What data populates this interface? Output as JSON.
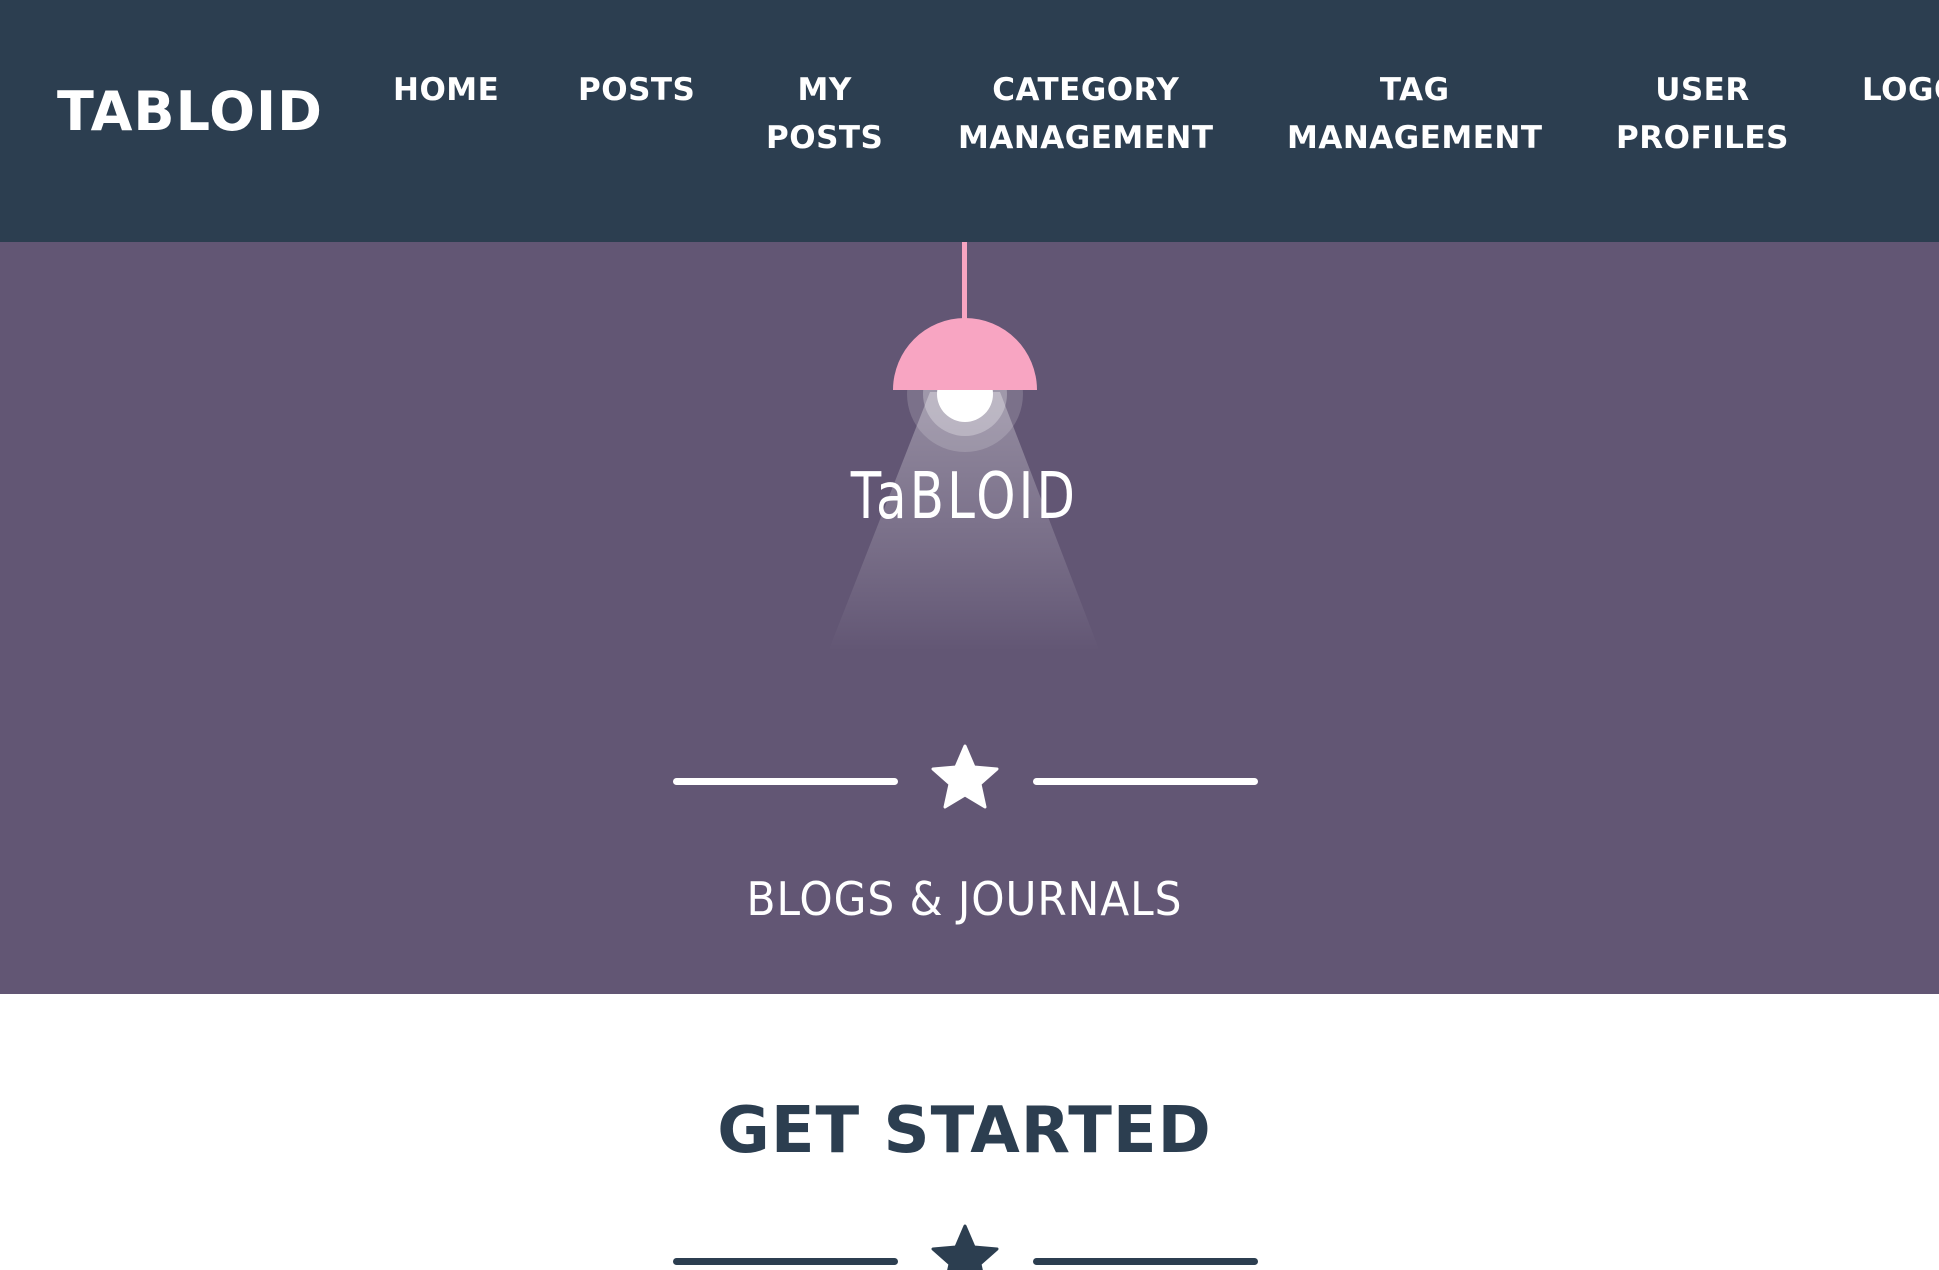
{
  "navbar": {
    "brand": "TABLOID",
    "items": [
      {
        "lines": [
          "HOME"
        ]
      },
      {
        "lines": [
          "POSTS"
        ]
      },
      {
        "lines": [
          "MY",
          "POSTS"
        ]
      },
      {
        "lines": [
          "CATEGORY",
          "MANAGEMENT"
        ]
      },
      {
        "lines": [
          "TAG",
          "MANAGEMENT"
        ]
      },
      {
        "lines": [
          "USER",
          "PROFILES"
        ]
      },
      {
        "lines": [
          "LOGOUT"
        ]
      }
    ]
  },
  "masthead": {
    "logo_text": "TaBLOID",
    "subheading": "BLOGS & JOURNALS",
    "divider_icon": "star-icon"
  },
  "section": {
    "title": "GET STARTED",
    "divider_icon": "star-icon"
  },
  "colors": {
    "navbar_bg": "#2c3e50",
    "masthead_bg": "#625674",
    "lamp_shade": "#f8a5c2",
    "heading_dark": "#2c3e50",
    "white": "#ffffff"
  }
}
